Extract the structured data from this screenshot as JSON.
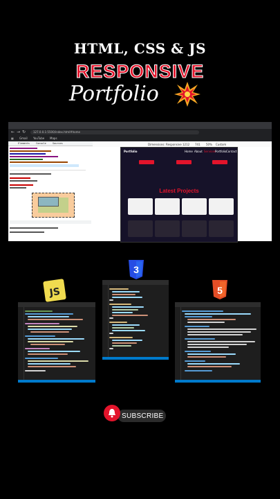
{
  "title": {
    "line1": "HTML, CSS & JS",
    "line2": "RESPONSIVE",
    "line3": "Portfolio"
  },
  "browser": {
    "url": "127.0.0.1:5500/index.html#home",
    "bookmarks": [
      "Gmail",
      "YouTube",
      "Maps"
    ],
    "devtools_tabs": [
      "Elements",
      "Console",
      "Sources"
    ],
    "device_toolbar": "Dimensions: Responsive",
    "device_width": "1212",
    "device_height": "741",
    "zoom": "50%",
    "device_mode": "Custom"
  },
  "website": {
    "brand": "Portfolio",
    "nav": [
      "Home",
      "About",
      "Services",
      "Portfolio",
      "Contact"
    ],
    "section_heading_prefix": "Latest",
    "section_heading_accent": "Projects"
  },
  "badges": {
    "js": "JS",
    "css": "3",
    "html": "5"
  },
  "subscribe": {
    "label": "SUBSCRIBE"
  },
  "colors": {
    "accent": "#e3142b",
    "js": "#f0db4f",
    "css": "#264de4",
    "html": "#e44d26",
    "editor_bg": "#1e1e1e",
    "editor_status": "#007acc"
  }
}
